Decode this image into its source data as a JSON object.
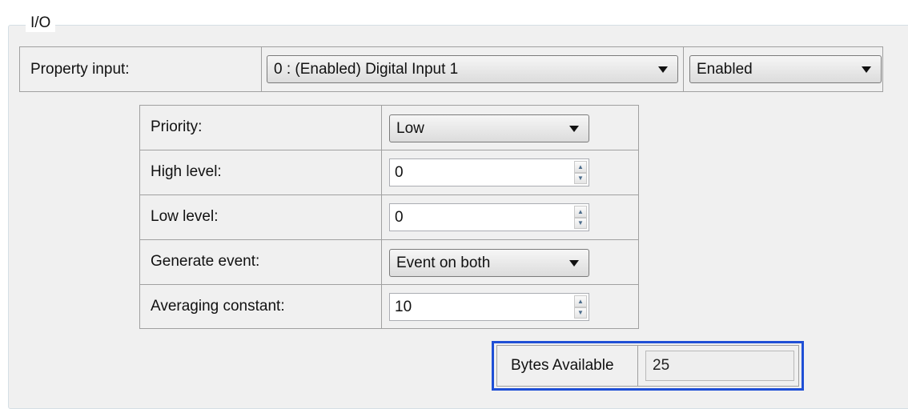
{
  "group": {
    "title": "I/O"
  },
  "property_input": {
    "label": "Property input:",
    "input_select": "0 : (Enabled) Digital Input 1",
    "state_select": "Enabled"
  },
  "settings": {
    "priority": {
      "label": "Priority:",
      "value": "Low"
    },
    "high_level": {
      "label": "High level:",
      "value": "0"
    },
    "low_level": {
      "label": "Low level:",
      "value": "0"
    },
    "generate_event": {
      "label": "Generate event:",
      "value": "Event on both"
    },
    "averaging_constant": {
      "label": "Averaging constant:",
      "value": "10"
    }
  },
  "bytes_available": {
    "label": "Bytes Available",
    "value": "25",
    "highlight_color": "#1f4fd6"
  },
  "icons": {
    "dropdown": "chevron-down-icon",
    "spin_up": "spin-up-icon",
    "spin_down": "spin-down-icon"
  }
}
